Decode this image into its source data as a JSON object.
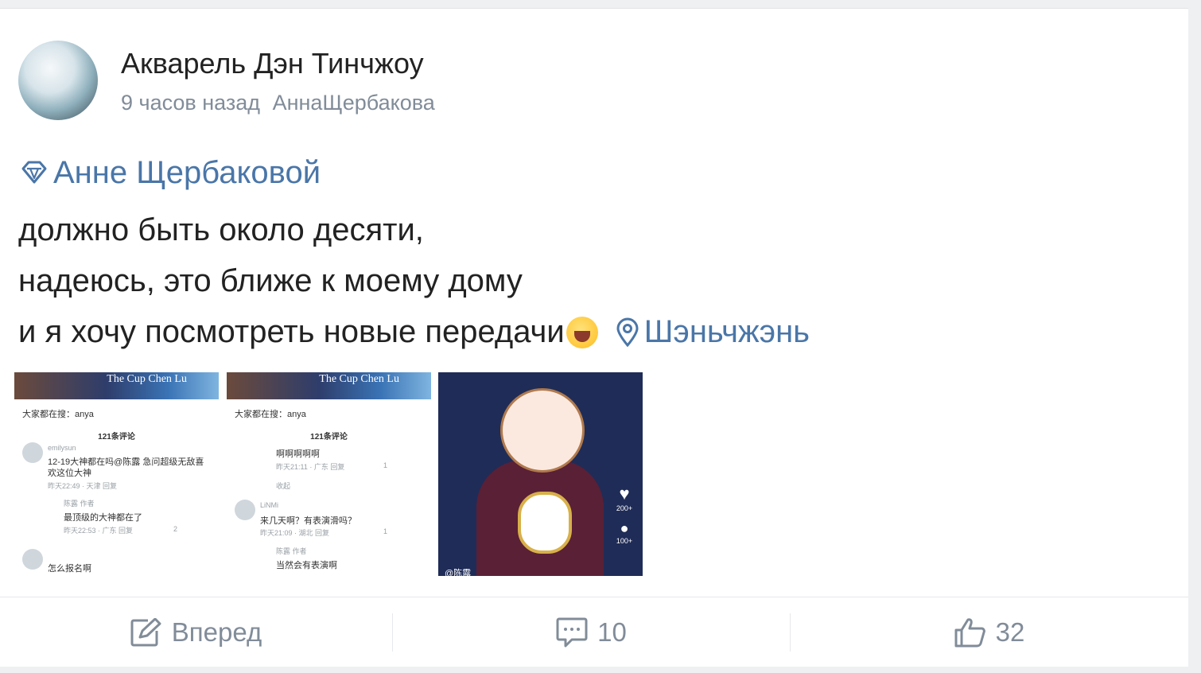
{
  "post": {
    "author": "Акварель Дэн Тинчжоу",
    "time": "9 часов назад",
    "tag": "АннаЩербакова",
    "mention": "Анне Щербаковой",
    "lines": [
      "должно быть около десяти,",
      "надеюсь, это ближе к моему дому",
      "и я хочу посмотреть новые передачи"
    ],
    "location": "Шэньчжэнь",
    "icons": {
      "mention": "diamond-icon",
      "location": "map-pin-icon",
      "emoji": "laughing-crying-emoji-icon"
    }
  },
  "photos": [
    {
      "banner": "The Cup Chen Lu",
      "search_label": "大家都在搜：anya",
      "comments_count": "121条评论",
      "rows": [
        "emilysun",
        "12-19大神都在吗@陈露 急问超级无敌喜",
        "欢这位大神",
        "昨天22:49 · 天津   回复",
        "陈露 作者",
        "最顶级的大神都在了",
        "昨天22:53 · 广东   回复",
        "怎么报名啊"
      ],
      "counts": [
        "2"
      ]
    },
    {
      "banner": "The Cup Chen Lu",
      "search_label": "大家都在搜：anya",
      "comments_count": "121条评论",
      "rows": [
        "啊啊啊啊啊",
        "昨天21:11 · 广东   回复",
        "收起",
        "LiNMi",
        "来几天啊？有表演滑吗？",
        "昨天21:09 · 湖北   回复",
        "陈露 作者",
        "当然会有表演啊"
      ],
      "counts": [
        "1",
        "1"
      ]
    },
    {
      "likes": "200+",
      "comments": "100+",
      "watermark": "@陈露"
    }
  ],
  "actions": {
    "share_label": "Вперед",
    "comment_count": "10",
    "like_count": "32"
  },
  "colors": {
    "link": "#4a76a8",
    "muted": "#818c99",
    "text": "#222222"
  }
}
